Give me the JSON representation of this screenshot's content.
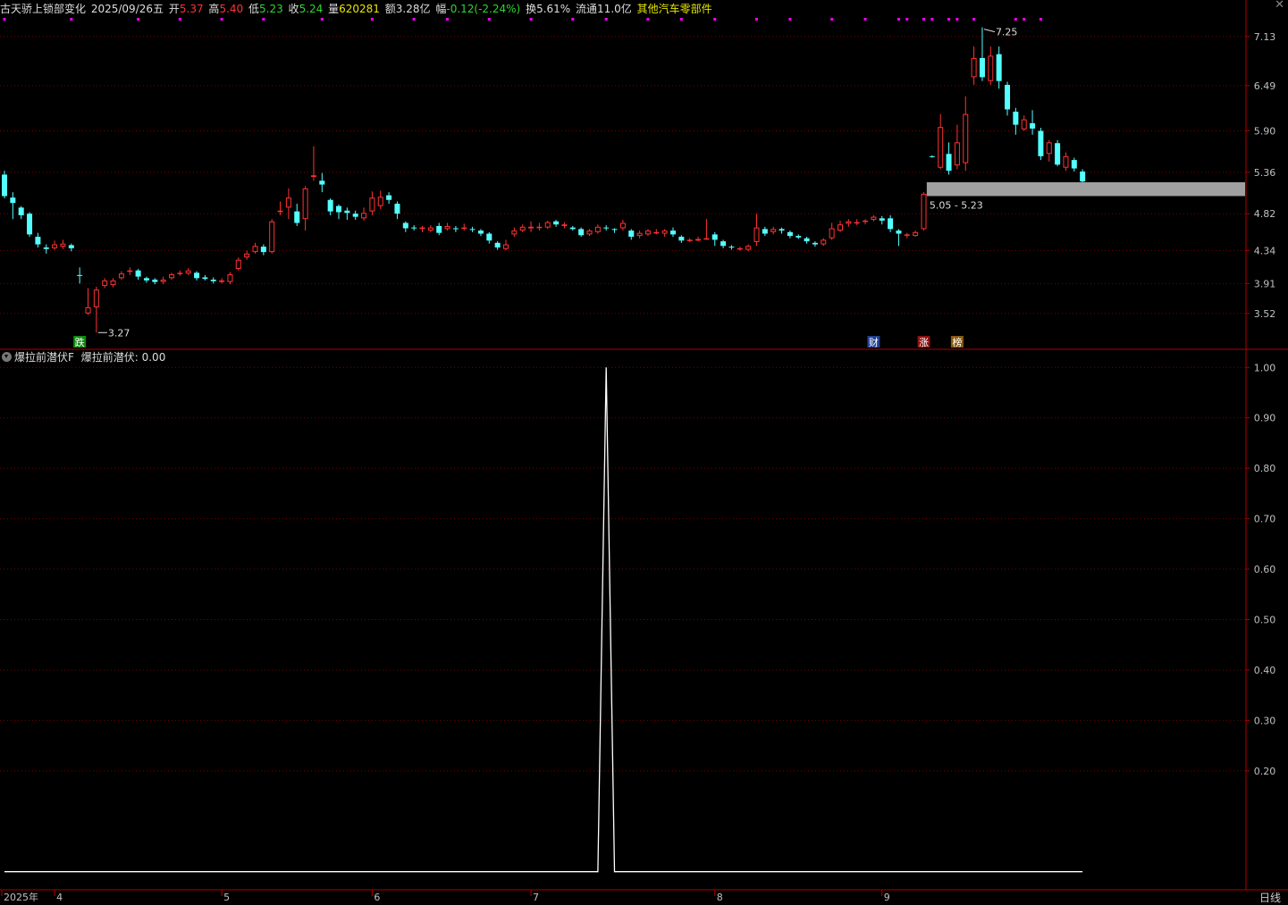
{
  "header": {
    "stock_name": "古天骄上锁部变化",
    "date": "2025/09/26",
    "weekday": "五",
    "open_label": "开",
    "open": "5.37",
    "high_label": "高",
    "high": "5.40",
    "low_label": "低",
    "low": "5.23",
    "close_label": "收",
    "close": "5.24",
    "volume_label": "量",
    "volume": "620281",
    "amount_label": "额",
    "amount": "3.28亿",
    "change_label": "幅",
    "change": "-0.12(-2.24%)",
    "turnover_label": "换",
    "turnover": "5.61%",
    "float_label": "流通",
    "float_cap": "11.0亿",
    "sector": "其他汽车零部件"
  },
  "indicator": {
    "name": "爆拉前潜伏F",
    "line_label": "爆拉前潜伏:",
    "value": "0.00"
  },
  "colors": {
    "up": "#ff3232",
    "down": "#54ffff",
    "grid": "#7a0000",
    "axis": "#b00000",
    "dots": "#ff00ff",
    "indicator_line": "#ffffff",
    "zone": "#a0a0a0",
    "tag_fall": "#0f8a0f",
    "tag_fin": "#20408f",
    "tag_limit": "#8a1010",
    "tag_rank": "#8a5a10"
  },
  "chart_data": [
    {
      "type": "candlestick",
      "title": "",
      "price_ticks": [
        "7.13",
        "6.49",
        "5.90",
        "5.36",
        "4.82",
        "4.34",
        "3.91",
        "3.52"
      ],
      "price_tick_values": [
        7.13,
        6.49,
        5.9,
        5.36,
        4.82,
        4.34,
        3.91,
        3.52
      ],
      "ylim": [
        3.25,
        7.35
      ],
      "x_ticks": [
        "2025年",
        "4",
        "5",
        "6",
        "7",
        "8",
        "9"
      ],
      "x_tick_index": [
        0,
        6,
        26,
        44,
        63,
        85,
        105
      ],
      "annotations": {
        "high": "7.25",
        "low": "3.27",
        "zone": "5.05 - 5.23"
      },
      "zone": [
        5.05,
        5.23
      ],
      "tags": [
        {
          "text": "跌",
          "index": 9,
          "kind": "fall"
        },
        {
          "text": "财",
          "index": 104,
          "kind": "fin"
        },
        {
          "text": "涨",
          "index": 110,
          "kind": "limit"
        },
        {
          "text": "榜",
          "index": 114,
          "kind": "rank"
        }
      ],
      "signal_dot_index": [
        0,
        8,
        16,
        21,
        26,
        31,
        38,
        44,
        49,
        53,
        58,
        63,
        68,
        72,
        77,
        81,
        85,
        90,
        94,
        99,
        103,
        107,
        108,
        110,
        111,
        113,
        114,
        116,
        121,
        122,
        124
      ],
      "candles": [
        [
          5.33,
          5.05,
          5.38,
          5.02
        ],
        [
          5.03,
          4.96,
          5.1,
          4.75
        ],
        [
          4.9,
          4.8,
          4.92,
          4.75
        ],
        [
          4.82,
          4.55,
          4.84,
          4.52
        ],
        [
          4.52,
          4.42,
          4.57,
          4.38
        ],
        [
          4.38,
          4.36,
          4.42,
          4.3
        ],
        [
          4.37,
          4.42,
          4.47,
          4.35
        ],
        [
          4.39,
          4.43,
          4.48,
          4.36
        ],
        [
          4.41,
          4.37,
          4.43,
          4.33
        ],
        [
          4.02,
          4.01,
          4.12,
          3.91
        ],
        [
          3.52,
          3.6,
          3.85,
          3.5
        ],
        [
          3.6,
          3.83,
          3.87,
          3.27
        ],
        [
          3.88,
          3.95,
          3.98,
          3.85
        ],
        [
          3.89,
          3.95,
          3.98,
          3.86
        ],
        [
          3.98,
          4.04,
          4.07,
          3.96
        ],
        [
          4.07,
          4.08,
          4.12,
          4.02
        ],
        [
          4.08,
          4.0,
          4.1,
          3.96
        ],
        [
          3.98,
          3.95,
          4.0,
          3.92
        ],
        [
          3.96,
          3.93,
          3.98,
          3.9
        ],
        [
          3.93,
          3.96,
          4.0,
          3.9
        ],
        [
          3.98,
          4.03,
          4.05,
          3.96
        ],
        [
          4.04,
          4.05,
          4.08,
          4.01
        ],
        [
          4.04,
          4.08,
          4.11,
          4.02
        ],
        [
          4.05,
          3.98,
          4.07,
          3.95
        ],
        [
          3.99,
          3.97,
          4.02,
          3.95
        ],
        [
          3.96,
          3.94,
          3.99,
          3.91
        ],
        [
          3.93,
          3.95,
          3.98,
          3.91
        ],
        [
          3.93,
          4.03,
          4.06,
          3.9
        ],
        [
          4.1,
          4.22,
          4.25,
          4.08
        ],
        [
          4.25,
          4.3,
          4.34,
          4.22
        ],
        [
          4.32,
          4.4,
          4.44,
          4.3
        ],
        [
          4.39,
          4.32,
          4.42,
          4.28
        ],
        [
          4.32,
          4.72,
          4.75,
          4.3
        ],
        [
          4.85,
          4.86,
          4.98,
          4.8
        ],
        [
          4.9,
          5.03,
          5.15,
          4.75
        ],
        [
          4.85,
          4.7,
          4.95,
          4.66
        ],
        [
          4.75,
          5.15,
          5.18,
          4.6
        ],
        [
          5.3,
          5.32,
          5.7,
          5.25
        ],
        [
          5.25,
          5.2,
          5.35,
          5.1
        ],
        [
          5.0,
          4.85,
          5.02,
          4.8
        ],
        [
          4.92,
          4.84,
          4.94,
          4.75
        ],
        [
          4.86,
          4.83,
          4.9,
          4.74
        ],
        [
          4.82,
          4.78,
          4.86,
          4.74
        ],
        [
          4.76,
          4.83,
          4.9,
          4.73
        ],
        [
          4.85,
          5.03,
          5.11,
          4.8
        ],
        [
          4.92,
          5.04,
          5.12,
          4.88
        ],
        [
          5.06,
          5.0,
          5.1,
          4.95
        ],
        [
          4.95,
          4.82,
          4.98,
          4.75
        ],
        [
          4.7,
          4.63,
          4.72,
          4.58
        ],
        [
          4.64,
          4.63,
          4.67,
          4.6
        ],
        [
          4.63,
          4.64,
          4.66,
          4.58
        ],
        [
          4.6,
          4.64,
          4.67,
          4.58
        ],
        [
          4.66,
          4.57,
          4.7,
          4.54
        ],
        [
          4.62,
          4.66,
          4.7,
          4.6
        ],
        [
          4.63,
          4.62,
          4.66,
          4.58
        ],
        [
          4.64,
          4.64,
          4.69,
          4.6
        ],
        [
          4.62,
          4.61,
          4.65,
          4.58
        ],
        [
          4.6,
          4.56,
          4.62,
          4.53
        ],
        [
          4.56,
          4.47,
          4.58,
          4.43
        ],
        [
          4.44,
          4.38,
          4.46,
          4.35
        ],
        [
          4.36,
          4.42,
          4.48,
          4.34
        ],
        [
          4.55,
          4.6,
          4.64,
          4.52
        ],
        [
          4.6,
          4.65,
          4.68,
          4.58
        ],
        [
          4.63,
          4.65,
          4.72,
          4.58
        ],
        [
          4.64,
          4.65,
          4.7,
          4.6
        ],
        [
          4.64,
          4.71,
          4.73,
          4.62
        ],
        [
          4.72,
          4.68,
          4.74,
          4.65
        ],
        [
          4.66,
          4.68,
          4.71,
          4.63
        ],
        [
          4.64,
          4.62,
          4.66,
          4.6
        ],
        [
          4.62,
          4.54,
          4.64,
          4.52
        ],
        [
          4.55,
          4.6,
          4.62,
          4.53
        ],
        [
          4.58,
          4.65,
          4.68,
          4.56
        ],
        [
          4.64,
          4.63,
          4.67,
          4.6
        ],
        [
          4.62,
          4.61,
          4.63,
          4.57
        ],
        [
          4.63,
          4.7,
          4.74,
          4.6
        ],
        [
          4.6,
          4.52,
          4.62,
          4.48
        ],
        [
          4.53,
          4.57,
          4.6,
          4.5
        ],
        [
          4.55,
          4.6,
          4.62,
          4.53
        ],
        [
          4.58,
          4.58,
          4.62,
          4.55
        ],
        [
          4.56,
          4.6,
          4.62,
          4.52
        ],
        [
          4.6,
          4.55,
          4.64,
          4.52
        ],
        [
          4.52,
          4.47,
          4.54,
          4.44
        ],
        [
          4.47,
          4.48,
          4.5,
          4.45
        ],
        [
          4.47,
          4.49,
          4.52,
          4.46
        ],
        [
          4.5,
          4.5,
          4.75,
          4.48
        ],
        [
          4.55,
          4.48,
          4.58,
          4.4
        ],
        [
          4.46,
          4.4,
          4.48,
          4.37
        ],
        [
          4.39,
          4.38,
          4.41,
          4.35
        ],
        [
          4.37,
          4.37,
          4.39,
          4.34
        ],
        [
          4.35,
          4.4,
          4.42,
          4.33
        ],
        [
          4.45,
          4.64,
          4.82,
          4.4
        ],
        [
          4.62,
          4.56,
          4.65,
          4.53
        ],
        [
          4.58,
          4.62,
          4.65,
          4.55
        ],
        [
          4.62,
          4.6,
          4.64,
          4.56
        ],
        [
          4.58,
          4.53,
          4.6,
          4.5
        ],
        [
          4.53,
          4.51,
          4.55,
          4.49
        ],
        [
          4.5,
          4.46,
          4.52,
          4.43
        ],
        [
          4.44,
          4.42,
          4.46,
          4.39
        ],
        [
          4.42,
          4.48,
          4.5,
          4.4
        ],
        [
          4.5,
          4.63,
          4.7,
          4.48
        ],
        [
          4.6,
          4.68,
          4.73,
          4.58
        ],
        [
          4.69,
          4.72,
          4.75,
          4.65
        ],
        [
          4.7,
          4.71,
          4.75,
          4.67
        ],
        [
          4.72,
          4.73,
          4.75,
          4.68
        ],
        [
          4.74,
          4.78,
          4.8,
          4.72
        ],
        [
          4.76,
          4.73,
          4.79,
          4.68
        ],
        [
          4.76,
          4.62,
          4.8,
          4.58
        ],
        [
          4.6,
          4.56,
          4.62,
          4.4
        ],
        [
          4.55,
          4.55,
          4.57,
          4.5
        ],
        [
          4.53,
          4.58,
          4.6,
          4.52
        ],
        [
          4.62,
          5.08,
          5.1,
          4.6
        ],
        [
          5.57,
          5.56,
          5.58,
          5.55
        ],
        [
          5.42,
          5.95,
          6.12,
          5.4
        ],
        [
          5.6,
          5.38,
          5.75,
          5.33
        ],
        [
          5.45,
          5.75,
          5.98,
          5.4
        ],
        [
          5.48,
          6.12,
          6.35,
          5.38
        ],
        [
          6.6,
          6.85,
          7.0,
          6.5
        ],
        [
          6.85,
          6.6,
          7.25,
          6.55
        ],
        [
          6.55,
          6.88,
          7.0,
          6.5
        ],
        [
          6.9,
          6.55,
          7.0,
          6.45
        ],
        [
          6.5,
          6.18,
          6.54,
          6.1
        ],
        [
          6.15,
          5.98,
          6.2,
          5.85
        ],
        [
          5.92,
          6.05,
          6.1,
          5.9
        ],
        [
          6.0,
          5.93,
          6.17,
          5.85
        ],
        [
          5.9,
          5.57,
          5.94,
          5.52
        ],
        [
          5.6,
          5.75,
          5.78,
          5.5
        ],
        [
          5.74,
          5.46,
          5.78,
          5.44
        ],
        [
          5.42,
          5.57,
          5.62,
          5.38
        ],
        [
          5.52,
          5.41,
          5.55,
          5.37
        ],
        [
          5.37,
          5.24,
          5.4,
          5.23
        ]
      ]
    },
    {
      "type": "line",
      "title": "",
      "series": [
        {
          "name": "爆拉前潜伏",
          "peak_index": 72,
          "peak_value": 1.0,
          "base_value": 0.0
        }
      ],
      "y_ticks": [
        "1.00",
        "0.90",
        "0.80",
        "0.70",
        "0.60",
        "0.50",
        "0.40",
        "0.30",
        "0.20"
      ],
      "y_tick_values": [
        1.0,
        0.9,
        0.8,
        0.7,
        0.6,
        0.5,
        0.4,
        0.3,
        0.2
      ],
      "ylim": [
        -0.02,
        1.02
      ]
    }
  ],
  "footer": {
    "period": "日线"
  }
}
